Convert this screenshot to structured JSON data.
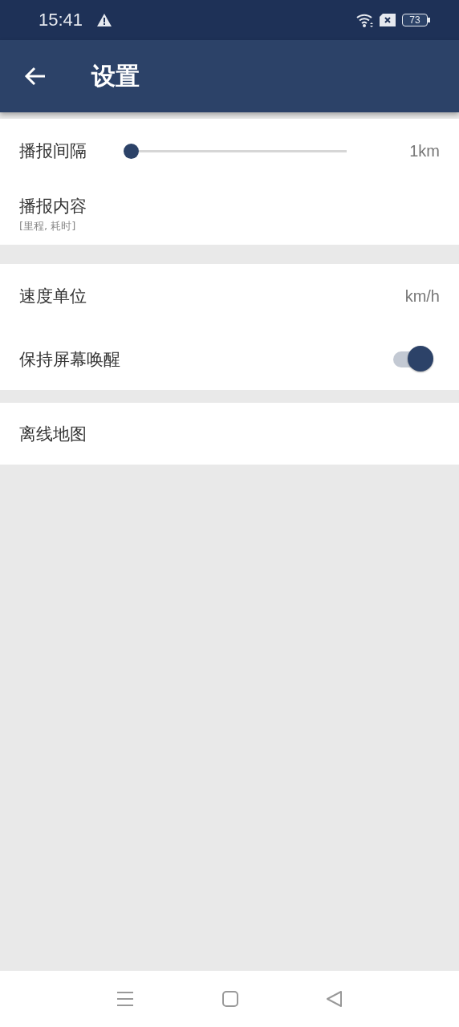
{
  "status_bar": {
    "time": "15:41",
    "battery": "73"
  },
  "app_bar": {
    "title": "设置"
  },
  "sections": [
    {
      "items": [
        {
          "kind": "slider",
          "label": "播报间隔",
          "level": 0,
          "reading": "1km"
        },
        {
          "kind": "text",
          "label": "播报内容",
          "subtitle": "[里程, 耗时]"
        }
      ]
    },
    {
      "items": [
        {
          "kind": "value",
          "label": "速度单位",
          "value": "km/h"
        },
        {
          "kind": "toggle",
          "label": "保持屏幕唤醒",
          "on": true
        }
      ]
    },
    {
      "items": [
        {
          "kind": "text",
          "label": "离线地图"
        }
      ]
    }
  ]
}
